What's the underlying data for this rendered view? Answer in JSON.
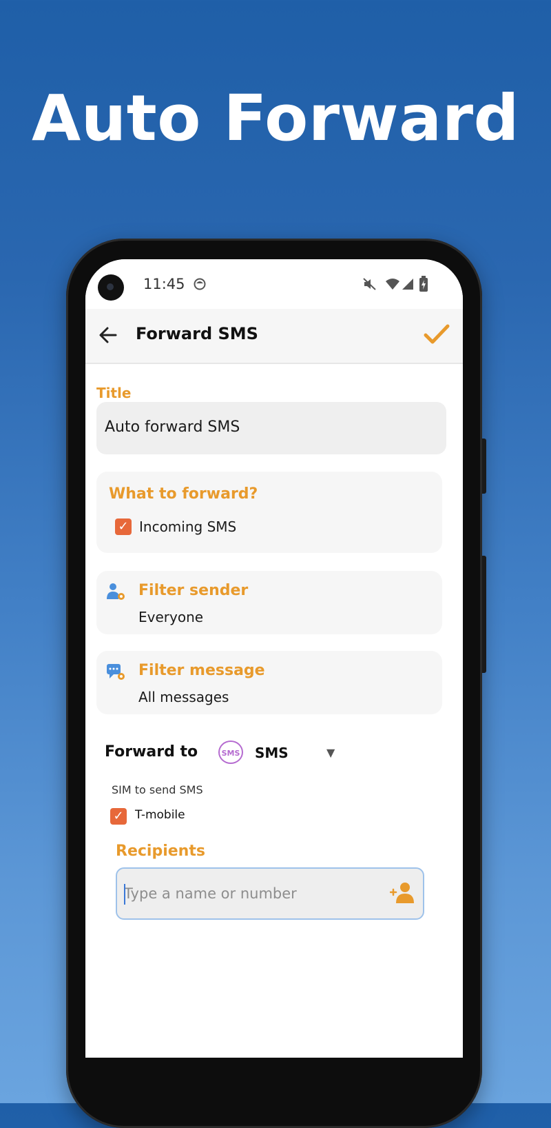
{
  "promo": {
    "headline": "Auto Forward"
  },
  "status_bar": {
    "time": "11:45"
  },
  "toolbar": {
    "title": "Forward SMS"
  },
  "form": {
    "title_label": "Title",
    "title_value": "Auto forward SMS",
    "what_to_forward": {
      "heading": "What to forward?",
      "option_label": "Incoming SMS",
      "option_checked": true
    },
    "filter_sender": {
      "heading": "Filter sender",
      "value": "Everyone"
    },
    "filter_message": {
      "heading": "Filter message",
      "value": "All messages"
    },
    "forward_to": {
      "label": "Forward to",
      "icon_text": "SMS",
      "selected": "SMS"
    },
    "sim": {
      "label": "SIM to send SMS",
      "option": "T-mobile",
      "checked": true
    },
    "recipients": {
      "label": "Recipients",
      "placeholder": "Type a name or number"
    }
  },
  "colors": {
    "accent_orange": "#e89a2c",
    "checkbox_orange": "#e7683a",
    "sms_purple": "#b56bd0",
    "icon_blue": "#4a8fdc"
  },
  "icons": {
    "back": "arrow-left-icon",
    "save": "check-icon",
    "filter_sender": "person-gear-icon",
    "filter_message": "message-gear-icon",
    "add_recipient": "add-person-icon"
  }
}
